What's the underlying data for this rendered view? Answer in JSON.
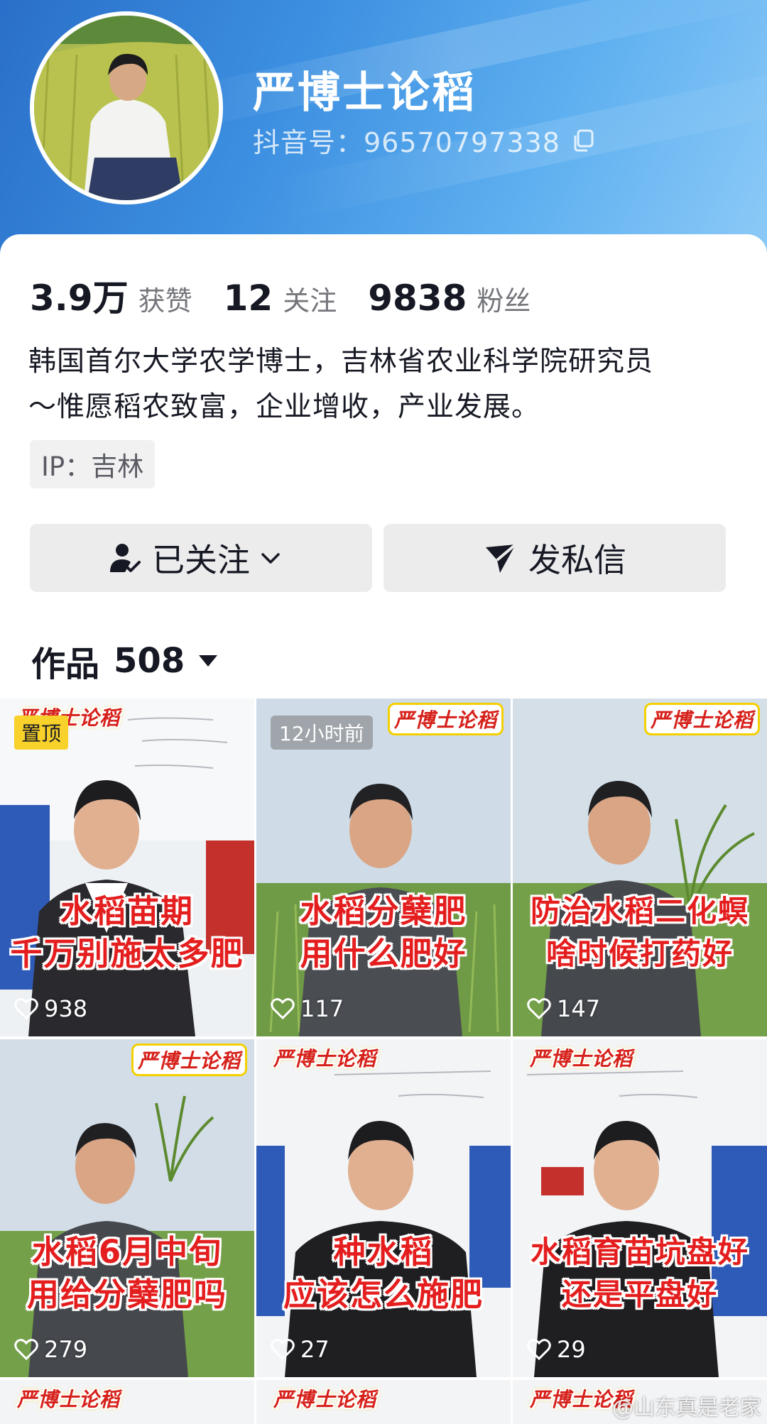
{
  "profile": {
    "name": "严博士论稻",
    "douyin_id": "抖音号：96570797338",
    "stats": [
      {
        "num": "3.9万",
        "label": "获赞"
      },
      {
        "num": "12",
        "label": "关注"
      },
      {
        "num": "9838",
        "label": "粉丝"
      }
    ],
    "bio_line1": "韩国首尔大学农学博士，吉林省农业科学院研究员",
    "bio_line2": "～惟愿稻农致富，企业增收，产业发展。",
    "ip": "IP：吉林"
  },
  "actions": {
    "follow_label": "已关注",
    "message_label": "发私信"
  },
  "works": {
    "label": "作品",
    "count": "508"
  },
  "videos": [
    {
      "brand": "严博士论稻",
      "badge": "置顶",
      "caption1": "水稻苗期",
      "caption2": "千万别施太多肥",
      "likes": "938"
    },
    {
      "brand": "严博士论稻",
      "badge": "12小时前",
      "caption1": "水稻分蘖肥",
      "caption2": "用什么肥好",
      "likes": "117"
    },
    {
      "brand": "严博士论稻",
      "badge": "",
      "caption1": "防治水稻二化螟",
      "caption2": "啥时候打药好",
      "likes": "147"
    },
    {
      "brand": "严博士论稻",
      "badge": "",
      "caption1": "水稻6月中旬",
      "caption2": "用给分蘖肥吗",
      "likes": "279"
    },
    {
      "brand": "严博士论稻",
      "badge": "",
      "caption1": "种水稻",
      "caption2": "应该怎么施肥",
      "likes": "27"
    },
    {
      "brand": "严博士论稻",
      "badge": "",
      "caption1": "水稻育苗坑盘好",
      "caption2": "还是平盘好",
      "likes": "29"
    },
    {
      "brand": "严博士论稻"
    },
    {
      "brand": "严博士论稻"
    },
    {
      "brand": "严博士论稻"
    }
  ],
  "watermark": "@山东真是老家",
  "colors": {
    "header_gradient_start": "#2a6fc9",
    "header_gradient_end": "#8ccaf7",
    "caption_red": "#e41e1e",
    "pin_yellow": "#f8d12a",
    "button_bg": "#ececed"
  },
  "icons": [
    "copy-icon",
    "user-check-icon",
    "chevron-down-icon",
    "send-icon",
    "caret-down-icon",
    "heart-icon"
  ]
}
